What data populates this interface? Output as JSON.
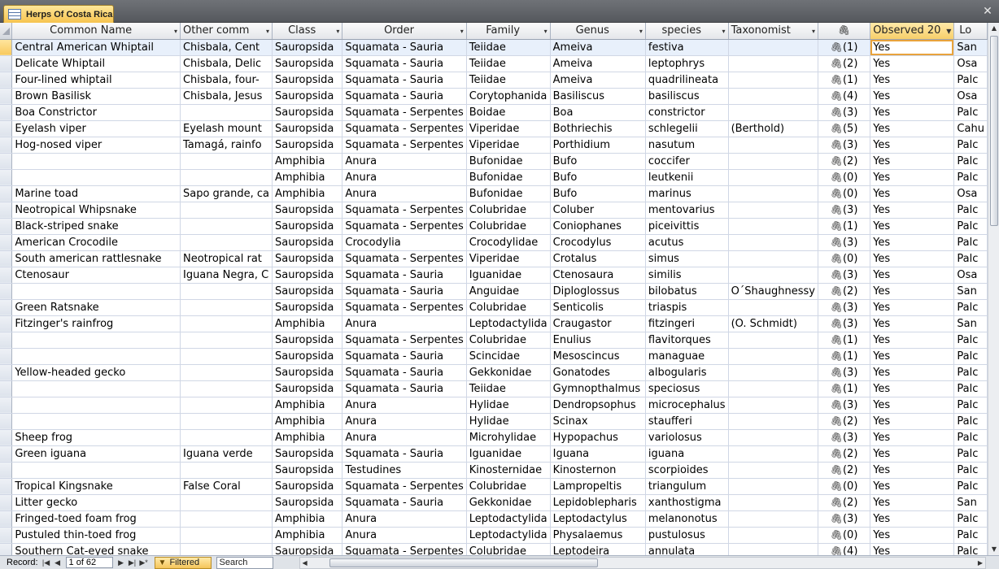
{
  "tab": {
    "title": "Herps Of Costa Rica",
    "icon": "table-icon",
    "close": "✕"
  },
  "columns": [
    {
      "label": "Common Name"
    },
    {
      "label": "Other comm"
    },
    {
      "label": "Class"
    },
    {
      "label": "Order"
    },
    {
      "label": "Family"
    },
    {
      "label": "Genus"
    },
    {
      "label": "species"
    },
    {
      "label": "Taxonomist"
    },
    {
      "label": "paperclip"
    },
    {
      "label": "Observed 20"
    },
    {
      "label": "Lo"
    }
  ],
  "rows": [
    [
      "Central American Whiptail",
      "Chisbala, Cent",
      "Sauropsida",
      "Squamata - Sauria",
      "Teiidae",
      "Ameiva",
      "festiva",
      "",
      "(1)",
      "Yes",
      "San"
    ],
    [
      "Delicate Whiptail",
      "Chisbala, Delic",
      "Sauropsida",
      "Squamata - Sauria",
      "Teiidae",
      "Ameiva",
      "leptophrys",
      "",
      "(2)",
      "Yes",
      "Osa"
    ],
    [
      "Four-lined whiptail",
      "Chisbala, four-",
      "Sauropsida",
      "Squamata - Sauria",
      "Teiidae",
      "Ameiva",
      "quadrilineata",
      "",
      "(1)",
      "Yes",
      "Palc"
    ],
    [
      "Brown Basilisk",
      "Chisbala, Jesus",
      "Sauropsida",
      "Squamata - Sauria",
      "Corytophanida",
      "Basiliscus",
      "basiliscus",
      "",
      "(4)",
      "Yes",
      "Osa"
    ],
    [
      "Boa Constrictor",
      "",
      "Sauropsida",
      "Squamata - Serpentes",
      "Boidae",
      "Boa",
      "constrictor",
      "",
      "(3)",
      "Yes",
      "Palc"
    ],
    [
      "Eyelash viper",
      "Eyelash mount",
      "Sauropsida",
      "Squamata - Serpentes",
      "Viperidae",
      "Bothriechis",
      "schlegelii",
      "(Berthold)",
      "(5)",
      "Yes",
      "Cahu"
    ],
    [
      "Hog-nosed viper",
      "Tamagá, rainfo",
      "Sauropsida",
      "Squamata - Serpentes",
      "Viperidae",
      "Porthidium",
      "nasutum",
      "",
      "(3)",
      "Yes",
      "Palc"
    ],
    [
      "",
      "",
      "Amphibia",
      "Anura",
      "Bufonidae",
      "Bufo",
      "coccifer",
      "",
      "(2)",
      "Yes",
      "Palc"
    ],
    [
      "",
      "",
      "Amphibia",
      "Anura",
      "Bufonidae",
      "Bufo",
      "leutkenii",
      "",
      "(0)",
      "Yes",
      "Palc"
    ],
    [
      "Marine toad",
      "Sapo grande, ca",
      "Amphibia",
      "Anura",
      "Bufonidae",
      "Bufo",
      "marinus",
      "",
      "(0)",
      "Yes",
      "Osa"
    ],
    [
      "Neotropical Whipsnake",
      "",
      "Sauropsida",
      "Squamata - Serpentes",
      "Colubridae",
      "Coluber",
      "mentovarius",
      "",
      "(3)",
      "Yes",
      "Palc"
    ],
    [
      "Black-striped snake",
      "",
      "Sauropsida",
      "Squamata - Serpentes",
      "Colubridae",
      "Coniophanes",
      "piceivittis",
      "",
      "(1)",
      "Yes",
      "Palc"
    ],
    [
      "American Crocodile",
      "",
      "Sauropsida",
      "Crocodylia",
      "Crocodylidae",
      "Crocodylus",
      "acutus",
      "",
      "(3)",
      "Yes",
      "Palc"
    ],
    [
      "South american rattlesnake",
      "Neotropical rat",
      "Sauropsida",
      "Squamata - Serpentes",
      "Viperidae",
      "Crotalus",
      "simus",
      "",
      "(0)",
      "Yes",
      "Palc"
    ],
    [
      "Ctenosaur",
      "Iguana Negra, C",
      "Sauropsida",
      "Squamata - Sauria",
      "Iguanidae",
      "Ctenosaura",
      "similis",
      "",
      "(3)",
      "Yes",
      "Osa"
    ],
    [
      "",
      "",
      "Sauropsida",
      "Squamata - Sauria",
      "Anguidae",
      "Diploglossus",
      "bilobatus",
      "O´Shaughnessy",
      "(2)",
      "Yes",
      "San"
    ],
    [
      "Green Ratsnake",
      "",
      "Sauropsida",
      "Squamata - Serpentes",
      "Colubridae",
      "Senticolis",
      "triaspis",
      "",
      "(3)",
      "Yes",
      "Palc"
    ],
    [
      "Fitzinger's rainfrog",
      "",
      "Amphibia",
      "Anura",
      "Leptodactylida",
      "Craugastor",
      "fitzingeri",
      "(O. Schmidt)",
      "(3)",
      "Yes",
      "San"
    ],
    [
      "",
      "",
      "Sauropsida",
      "Squamata - Serpentes",
      "Colubridae",
      "Enulius",
      "flavitorques",
      "",
      "(1)",
      "Yes",
      "Palc"
    ],
    [
      "",
      "",
      "Sauropsida",
      "Squamata - Sauria",
      "Scincidae",
      "Mesoscincus",
      "managuae",
      "",
      "(1)",
      "Yes",
      "Palc"
    ],
    [
      "Yellow-headed gecko",
      "",
      "Sauropsida",
      "Squamata - Sauria",
      "Gekkonidae",
      "Gonatodes",
      "albogularis",
      "",
      "(3)",
      "Yes",
      "Palc"
    ],
    [
      "",
      "",
      "Sauropsida",
      "Squamata - Sauria",
      "Teiidae",
      "Gymnopthalmus",
      "speciosus",
      "",
      "(1)",
      "Yes",
      "Palc"
    ],
    [
      "",
      "",
      "Amphibia",
      "Anura",
      "Hylidae",
      "Dendropsophus",
      "microcephalus",
      "",
      "(3)",
      "Yes",
      "Palc"
    ],
    [
      "",
      "",
      "Amphibia",
      "Anura",
      "Hylidae",
      "Scinax",
      "staufferi",
      "",
      "(2)",
      "Yes",
      "Palc"
    ],
    [
      "Sheep frog",
      "",
      "Amphibia",
      "Anura",
      "Microhylidae",
      "Hypopachus",
      "variolosus",
      "",
      "(3)",
      "Yes",
      "Palc"
    ],
    [
      "Green iguana",
      "Iguana verde",
      "Sauropsida",
      "Squamata - Sauria",
      "Iguanidae",
      "Iguana",
      "iguana",
      "",
      "(2)",
      "Yes",
      "Palc"
    ],
    [
      "",
      "",
      "Sauropsida",
      "Testudines",
      "Kinosternidae",
      "Kinosternon",
      "scorpioides",
      "",
      "(2)",
      "Yes",
      "Palc"
    ],
    [
      "Tropical Kingsnake",
      " False Coral",
      "Sauropsida",
      "Squamata - Serpentes",
      "Colubridae",
      "Lampropeltis",
      "triangulum",
      "",
      "(0)",
      "Yes",
      "Palc"
    ],
    [
      " Litter gecko",
      "",
      "Sauropsida",
      "Squamata - Sauria",
      "Gekkonidae",
      "Lepidoblepharis",
      "xanthostigma",
      "",
      "(2)",
      "Yes",
      "San"
    ],
    [
      "Fringed-toed foam frog",
      "",
      "Amphibia",
      "Anura",
      "Leptodactylida",
      "Leptodactylus",
      "melanonotus",
      "",
      "(3)",
      "Yes",
      "Palc"
    ],
    [
      "Pustuled thin-toed frog",
      "",
      "Amphibia",
      "Anura",
      "Leptodactylida",
      "Physalaemus",
      "pustulosus",
      "",
      "(0)",
      "Yes",
      "Palc"
    ],
    [
      "Southern Cat-eyed snake",
      "",
      "Sauropsida",
      "Squamata - Serpentes",
      "Colubridae",
      "Leptodeira",
      "annulata",
      "",
      "(4)",
      "Yes",
      "Palc"
    ]
  ],
  "status": {
    "record_label": "Record:",
    "record_value": "1 of 62",
    "filtered": "Filtered",
    "search": "Search"
  }
}
